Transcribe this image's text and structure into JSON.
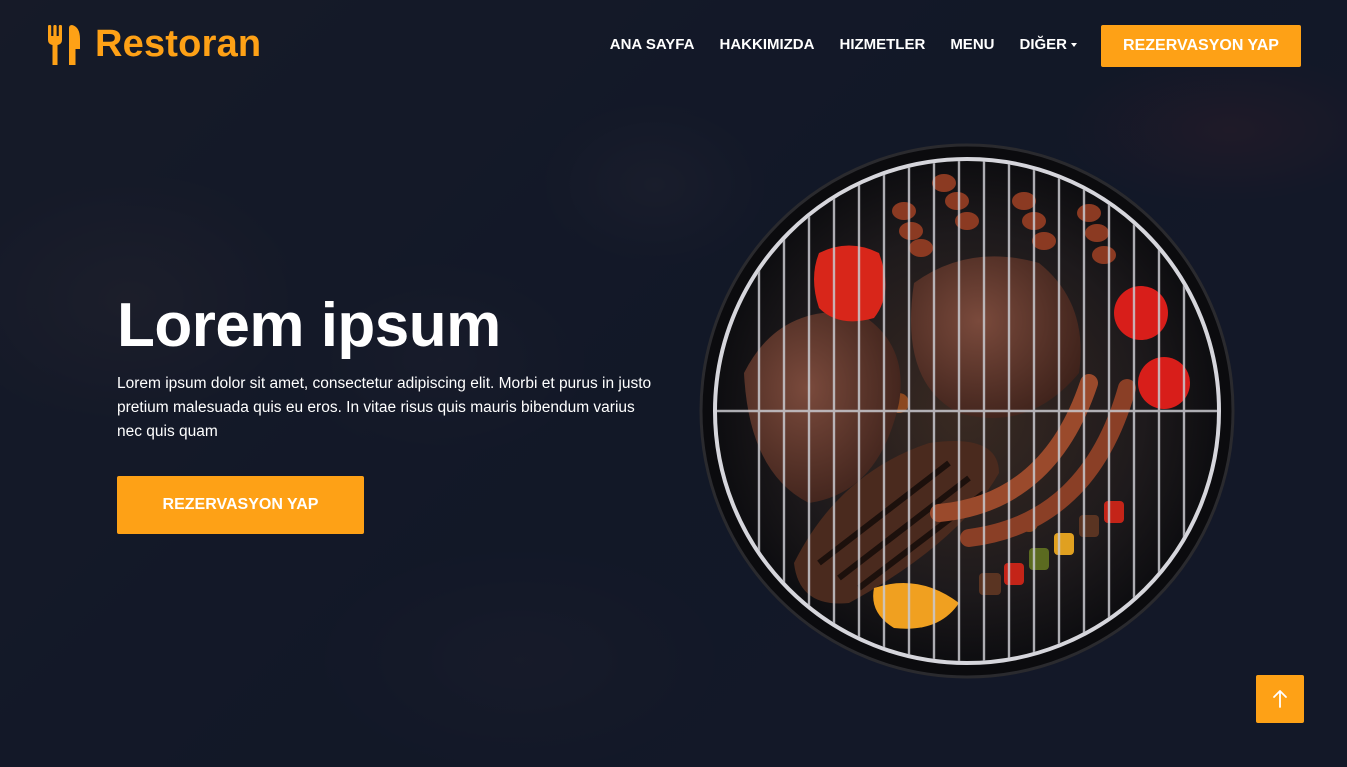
{
  "brand": {
    "name": "Restoran",
    "icon": "utensils-icon",
    "color": "#fea116"
  },
  "nav": {
    "items": [
      {
        "label": "ANA SAYFA"
      },
      {
        "label": "HAKKIMIZDA"
      },
      {
        "label": "HIZMETLER"
      },
      {
        "label": "MENU"
      },
      {
        "label": "DIĞER",
        "dropdown": true
      }
    ],
    "cta": "REZERVASYON YAP"
  },
  "hero": {
    "title": "Lorem ipsum",
    "text": "Lorem ipsum dolor sit amet, consectetur adipiscing elit. Morbi et purus in justo pretium malesuada quis eu eros. In vitae risus quis mauris bibendum varius nec quis quam",
    "button": "REZERVASYON YAP",
    "image": "grilled-meat-barbecue-image"
  },
  "back_to_top": {
    "icon": "arrow-up-icon"
  },
  "colors": {
    "accent": "#fea116",
    "dark": "#0f172b",
    "text": "#ffffff"
  }
}
